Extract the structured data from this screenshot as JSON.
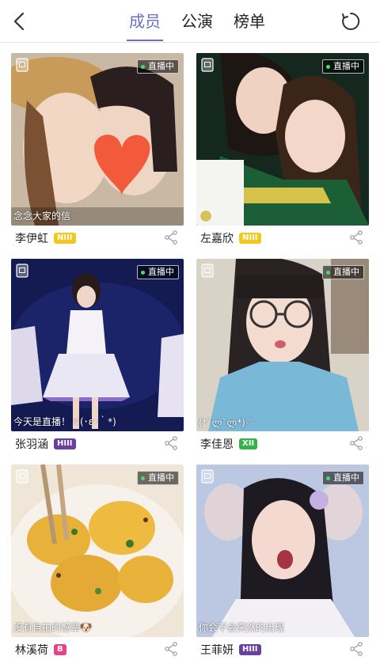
{
  "tabs": [
    {
      "label": "成员",
      "active": true
    },
    {
      "label": "公演",
      "active": false
    },
    {
      "label": "榜单",
      "active": false
    }
  ],
  "accent_color": "#6a6fc0",
  "live_label": "直播中",
  "members": [
    {
      "name": "李伊虹",
      "team": "NIII",
      "team_color": "#f2c81f",
      "caption": "念念大家的信"
    },
    {
      "name": "左嘉欣",
      "team": "NIII",
      "team_color": "#f2c81f",
      "caption": ""
    },
    {
      "name": "张羽涵",
      "team": "HIII",
      "team_color": "#6b3fa0",
      "caption": "今天是直播！ヾ(･ε･｀*)"
    },
    {
      "name": "李佳恩",
      "team": "XII",
      "team_color": "#36b24a",
      "caption": "(*´ლ`ლ*)♡"
    },
    {
      "name": "林溪荷",
      "team": "B",
      "team_color": "#e8418c",
      "caption": "没有自拍的憾辈🐶"
    },
    {
      "name": "王菲妍",
      "team": "HIII",
      "team_color": "#6b3fa0",
      "caption": "你会不会突然的出现"
    }
  ],
  "icons": {
    "back": "chevron-left-icon",
    "refresh": "refresh-icon",
    "share": "share-icon",
    "doc": "document-icon"
  }
}
